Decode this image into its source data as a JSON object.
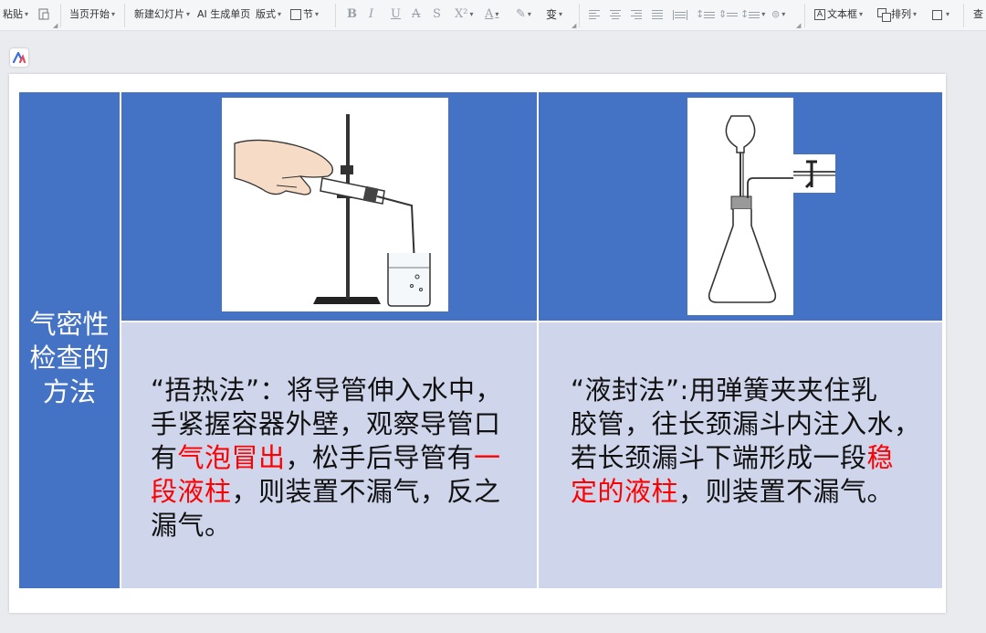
{
  "toolbar": {
    "paste": "粘贴",
    "start_from_current": "当页开始",
    "new_slide": "新建幻灯片",
    "ai_single_page": "AI 生成单页",
    "layout": "版式",
    "section": "节",
    "bold": "B",
    "italic": "I",
    "underline": "U",
    "strikethrough": "A",
    "shadow": "S",
    "superscript": "X²",
    "font_color": "A",
    "highlight": "✎",
    "phonetic": "变",
    "textbox": "文本框",
    "arrange": "排列",
    "find": "查"
  },
  "slide": {
    "left_title": [
      "气密性",
      "检查的",
      "方法"
    ],
    "method1": {
      "line1": "“捂热法”：将导管伸入水中，",
      "line2": "手紧握容器外壁，观察导管口",
      "line3_a": "有",
      "line3_red": "气泡冒出",
      "line3_b": "，松手后导管有",
      "line3_red2": "一",
      "line4_red": "段液柱",
      "line4_b": "，则装置不漏气，反之",
      "line5": "漏气。"
    },
    "method2": {
      "line1": "“液封法”:用弹簧夹夹住乳",
      "line2": "胶管，往长颈漏斗内注入水，",
      "line3_a": "若长颈漏斗下端形成一段",
      "line3_red": "稳",
      "line4_red": "定的液柱",
      "line4_b": "，则装置不漏气。"
    }
  },
  "colors": {
    "header_blue": "#4472c4",
    "body_lavender": "#cfd5ea",
    "highlight_red": "#ff0000"
  }
}
